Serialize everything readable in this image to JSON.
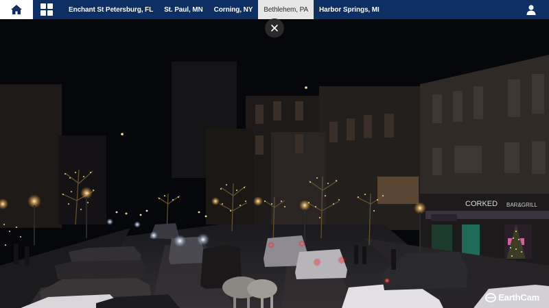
{
  "nav": {
    "home_icon": "home-icon",
    "grid_icon": "grid-menu-icon",
    "user_icon": "user-icon",
    "tabs": [
      {
        "label": "Enchant St Petersburg, FL",
        "active": false
      },
      {
        "label": "St. Paul, MN",
        "active": false
      },
      {
        "label": "Corning, NY",
        "active": false
      },
      {
        "label": "Bethlehem, PA",
        "active": true
      },
      {
        "label": "Harbor Springs, MI",
        "active": false
      }
    ]
  },
  "player": {
    "close_icon": "close-icon",
    "brand": "EarthCam",
    "storefront_sign": "CORKED",
    "storefront_sign_sub": "BAR&GRILL"
  },
  "colors": {
    "nav_bar": "#0e2f63",
    "active_tab": "#e6e6e6",
    "light_warm": "#ffd58a"
  }
}
